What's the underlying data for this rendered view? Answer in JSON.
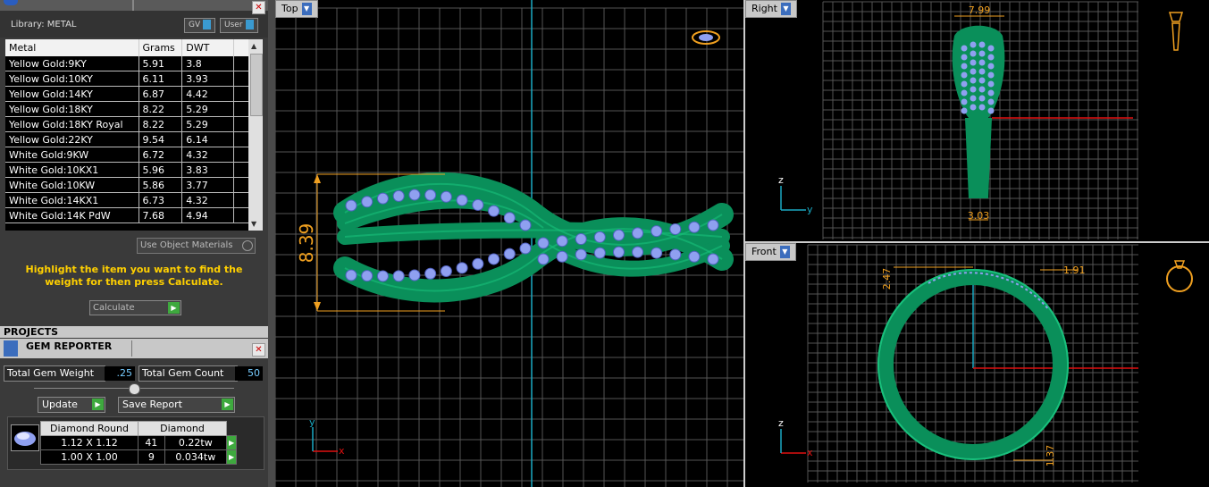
{
  "library": {
    "title": "Library: METAL",
    "gv_label": "GV",
    "user_label": "User",
    "columns": [
      "Metal",
      "Grams",
      "DWT"
    ],
    "rows": [
      [
        "Yellow Gold:9KY",
        "5.91",
        "3.8"
      ],
      [
        "Yellow Gold:10KY",
        "6.11",
        "3.93"
      ],
      [
        "Yellow Gold:14KY",
        "6.87",
        "4.42"
      ],
      [
        "Yellow Gold:18KY",
        "8.22",
        "5.29"
      ],
      [
        "Yellow Gold:18KY Royal",
        "8.22",
        "5.29"
      ],
      [
        "Yellow Gold:22KY",
        "9.54",
        "6.14"
      ],
      [
        "White Gold:9KW",
        "6.72",
        "4.32"
      ],
      [
        "White Gold:10KX1",
        "5.96",
        "3.83"
      ],
      [
        "White Gold:10KW",
        "5.86",
        "3.77"
      ],
      [
        "White Gold:14KX1",
        "6.73",
        "4.32"
      ],
      [
        "White Gold:14K PdW",
        "7.68",
        "4.94"
      ]
    ],
    "use_object_materials": "Use Object Materials",
    "hint": "Highlight the item you want to find the weight for then press Calculate.",
    "calculate_label": "Calculate"
  },
  "projects_title": "PROJECTS",
  "gem_reporter": {
    "title": "GEM REPORTER",
    "total_weight_label": "Total Gem Weight",
    "total_weight_value": ".25",
    "total_count_label": "Total Gem Count",
    "total_count_value": "50",
    "update_label": "Update",
    "save_report_label": "Save Report",
    "table_headers": [
      "Diamond Round",
      "Diamond"
    ],
    "rows": [
      [
        "1.12 X 1.12",
        "41",
        "0.22tw"
      ],
      [
        "1.00 X 1.00",
        "9",
        "0.034tw"
      ]
    ]
  },
  "viewports": {
    "top": {
      "label": "Top",
      "dimension": "8.39",
      "axis_y": "y",
      "axis_x": "x"
    },
    "right": {
      "label": "Right",
      "dimension_top": "7.99",
      "dimension_bottom": "3.03",
      "axis_z": "z",
      "axis_y": "y"
    },
    "front": {
      "label": "Front",
      "dimension_a": "2.47",
      "dimension_b": "1.91",
      "dimension_c": "1.37",
      "axis_z": "z",
      "axis_x": "x"
    }
  },
  "colors": {
    "ring": "#0a8f5a",
    "gem": "#8fa0f0",
    "grid": "#555555",
    "axis_cyan": "#1aa9c2",
    "axis_red": "#e01010",
    "dimension": "#f0a020"
  }
}
